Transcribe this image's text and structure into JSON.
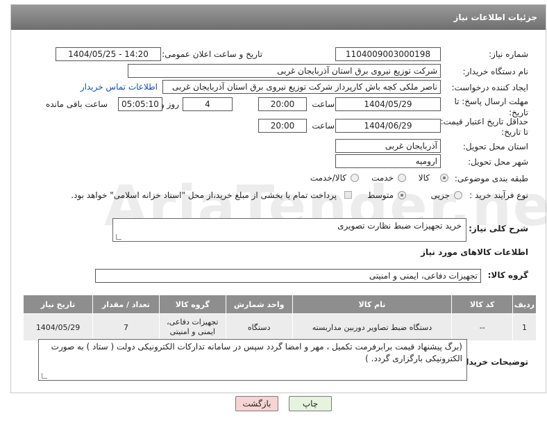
{
  "header": {
    "title": "جزئیات اطلاعات نیاز"
  },
  "form": {
    "need_number_label": "شماره نیاز:",
    "need_number": "1104009003000198",
    "announce_label": "تاریخ و ساعت اعلان عمومی:",
    "announce_value": "1404/05/25 - 14:20",
    "buyer_org_label": "نام دستگاه خریدار:",
    "buyer_org": "شرکت توزیع نیروی برق استان آذربایجان غربی",
    "requester_label": "ایجاد کننده درخواست:",
    "requester": "ناصر ملکی کچه باش کارپرداز شرکت توزیع نیروی برق استان آذربایجان غربی",
    "contact_link": "اطلاعات تماس خریدار",
    "deadline_label": "مهلت ارسال پاسخ: تا تاریخ:",
    "deadline_date": "1404/05/29",
    "time_label": "ساعت",
    "deadline_time": "20:00",
    "days_value": "4",
    "days_label": "روز و",
    "remaining_value": "05:05:10",
    "remaining_label": "ساعت باقی مانده",
    "validity_label": "حداقل تاریخ اعتبار قیمت: تا تاریخ:",
    "validity_date": "1404/06/29",
    "validity_time": "20:00",
    "province_label": "استان محل تحویل:",
    "province": "آذربایجان غربی",
    "city_label": "شهر محل تحویل:",
    "city": "ارومیه",
    "category_label": "طبقه بندی موضوعی:",
    "category_options": [
      "کالا",
      "خدمت",
      "کالا/خدمت"
    ],
    "process_label": "نوع فرآیند خرید :",
    "process_options": [
      "جزیی",
      "متوسط"
    ],
    "payment_note": "پرداخت تمام یا بخشی از مبلغ خرید،از محل \"اسناد خزانه اسلامی\" خواهد بود.",
    "summary_label": "شرح کلی نیاز:",
    "summary": "خرید تجهیزات ضبط نظارت تصویری",
    "goods_info_title": "اطلاعات کالاهای مورد نیاز",
    "goods_group_label": "گروه کالا:",
    "goods_group": "تجهیزات دفاعی، ایمنی و امنیتی",
    "buyer_notes_label": "توضیحات خریدار:",
    "buyer_notes": "(برگ پیشنهاد قیمت برابرفرمت تکمیل ، مهر و امضا گردد سپس در سامانه تدارکات الکترونیکی دولت ( ستاد ) به صورت الکترونیکی  بارگزاری گردد. )"
  },
  "table": {
    "headers": [
      "ردیف",
      "کد کالا",
      "نام کالا",
      "واحد شمارش",
      "گروه کالا",
      "تعداد / مقدار",
      "تاریخ نیاز"
    ],
    "rows": [
      [
        "1",
        "--",
        "دستگاه ضبط تصاویر دوربین مداربسته",
        "دستگاه",
        "تجهیزات دفاعی، ایمنی و امنیتی",
        "7",
        "1404/05/29"
      ]
    ]
  },
  "buttons": {
    "print": "چاپ",
    "back": "بازگشت"
  },
  "watermark": "AriaTender.neT",
  "colors": {
    "header_bg": "#7f7f7f",
    "table_header": "#8e8e8e",
    "link": "#1a4ca8",
    "back_btn": "#f6d4d4",
    "print_btn": "#e6f3df"
  }
}
